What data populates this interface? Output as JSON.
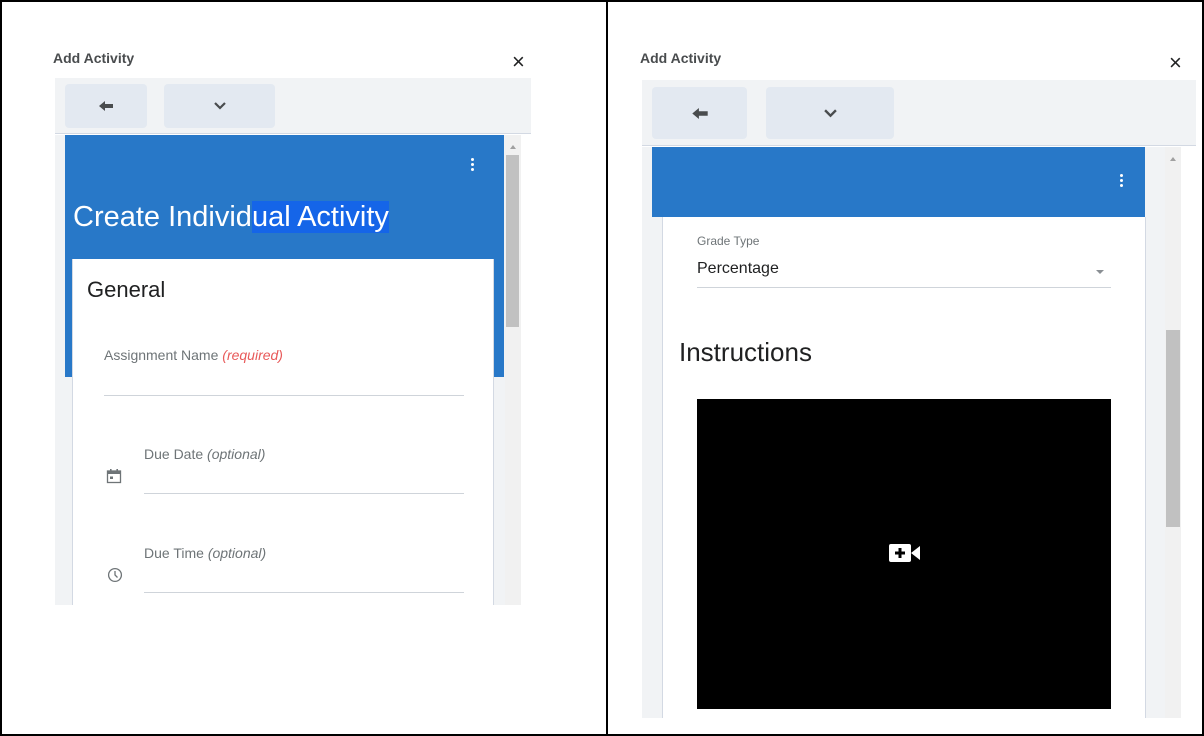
{
  "left_panel": {
    "title": "Add Activity",
    "close_label": "×",
    "header": {
      "title_before": "Create Individ",
      "title_selected": "ual Activity"
    },
    "card": {
      "section_title": "General",
      "fields": [
        {
          "label": "Assignment Name",
          "hint": "(required)",
          "icon": ""
        },
        {
          "label": "Due Date",
          "hint": "(optional)",
          "icon": "calendar-icon"
        },
        {
          "label": "Due Time",
          "hint": "(optional)",
          "icon": "clock-icon"
        }
      ]
    }
  },
  "right_panel": {
    "title": "Add Activity",
    "close_label": "×",
    "grade_type": {
      "label": "Grade Type",
      "value": "Percentage"
    },
    "instructions_title": "Instructions",
    "video_icon": "add-video-icon"
  },
  "toolbar": {
    "back_icon": "arrow-left-icon",
    "menu_icon": "chevron-down-icon"
  },
  "colors": {
    "header_blue": "#2878c8",
    "selection_blue": "#1565e8",
    "required_red": "#e85a5a",
    "toolbar_bg": "#f1f3f5"
  }
}
